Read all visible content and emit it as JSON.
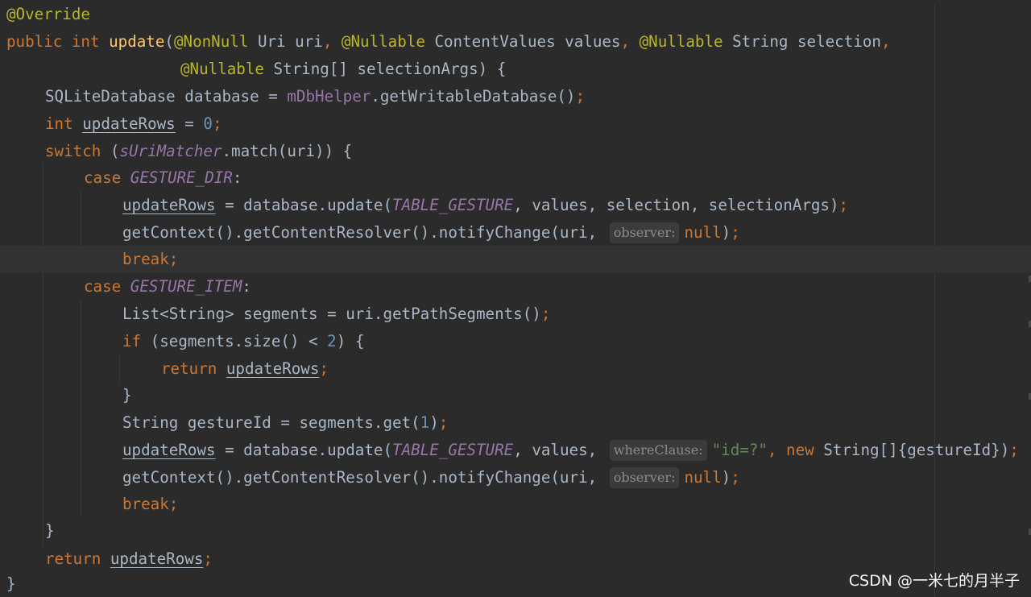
{
  "hints": {
    "observer": "observer:",
    "where_clause": "whereClause:"
  },
  "tokens": {
    "override": "@Override",
    "public_kw": "public",
    "int_kw": "int",
    "update_fn": "update",
    "paren_open": "(",
    "nonnull": "@NonNull",
    "uri_param": " Uri uri",
    "comma": ", ",
    "nullable": "@Nullable",
    "cv_values": " ContentValues values",
    "string_selection": " String selection",
    "trailing_comma": ",",
    "string_array_args": " String[] selectionArgs) {",
    "sqlite_decl": "SQLiteDatabase database = ",
    "db_helper": "mDbHelper",
    "get_writable": ".getWritableDatabase()",
    "semicolon": ";",
    "update_rows": "updateRows",
    "assign": " = ",
    "zero": "0",
    "switch_kw": "switch",
    "switch_open": " (",
    "uri_matcher": "sUriMatcher",
    "match_call": ".match(uri)) {",
    "case_kw": "case",
    "gesture_dir": "GESTURE_DIR",
    "colon": ":",
    "db_update": " = database.update(",
    "table_gesture": "TABLE_GESTURE",
    "values_sel_args": ", values, selection, selectionArgs)",
    "notify_prefix": "getContext().getContentResolver().notifyChange(uri, ",
    "null_kw": "null",
    "close_paren": ")",
    "break_kw": "break",
    "gesture_item": "GESTURE_ITEM",
    "list_segments": "List<String> segments = uri.getPathSegments()",
    "if_kw": "if",
    "if_cond_a": " (segments.size() < ",
    "two": "2",
    "if_cond_b": ") {",
    "return_kw": "return",
    "close_brace": "}",
    "gesture_id_decl": "String gestureId = segments.get(",
    "one": "1",
    "values_comma": ", values, ",
    "id_literal": "\"id=?\"",
    "new_kw": "new",
    "string_array_init": " String[]{gestureId})",
    "space": " "
  },
  "watermark": "CSDN @一米七的月半子"
}
